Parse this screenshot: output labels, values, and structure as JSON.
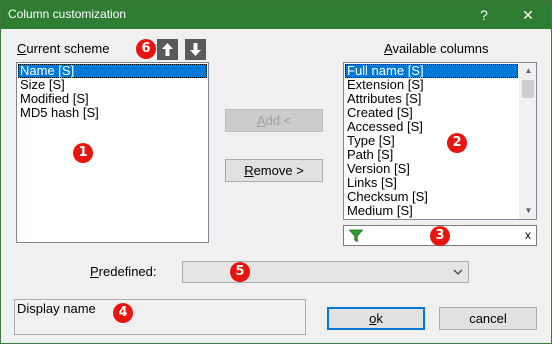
{
  "window": {
    "title": "Column customization",
    "help_label": "?",
    "close_label": "✕"
  },
  "current_scheme": {
    "label": "Current scheme",
    "items": [
      "Name [S]",
      "Size [S]",
      "Modified [S]",
      "MD5 hash [S]"
    ],
    "selected_index": 0
  },
  "available_columns": {
    "label": "Available columns",
    "items": [
      "Full name [S]",
      "Extension [S]",
      "Attributes [S]",
      "Created [S]",
      "Accessed [S]",
      "Type [S]",
      "Path [S]",
      "Version [S]",
      "Links [S]",
      "Checksum [S]",
      "Medium [S]"
    ],
    "selected_index": 0
  },
  "buttons": {
    "add": "Add <",
    "remove": "Remove >",
    "ok": "ok",
    "cancel": "cancel",
    "move_up": "🡅",
    "move_down": "🡇"
  },
  "filter": {
    "value": "",
    "clear_label": "x"
  },
  "predefined": {
    "label": "Predefined:",
    "selected": ""
  },
  "display_name": {
    "label": "Display name"
  },
  "badges": [
    "1",
    "2",
    "3",
    "4",
    "5",
    "6"
  ],
  "colors": {
    "titlebar": "#2e7d32",
    "selection": "#0078d7",
    "badge": "#e8150f",
    "funnel": "#2e9e2e"
  }
}
